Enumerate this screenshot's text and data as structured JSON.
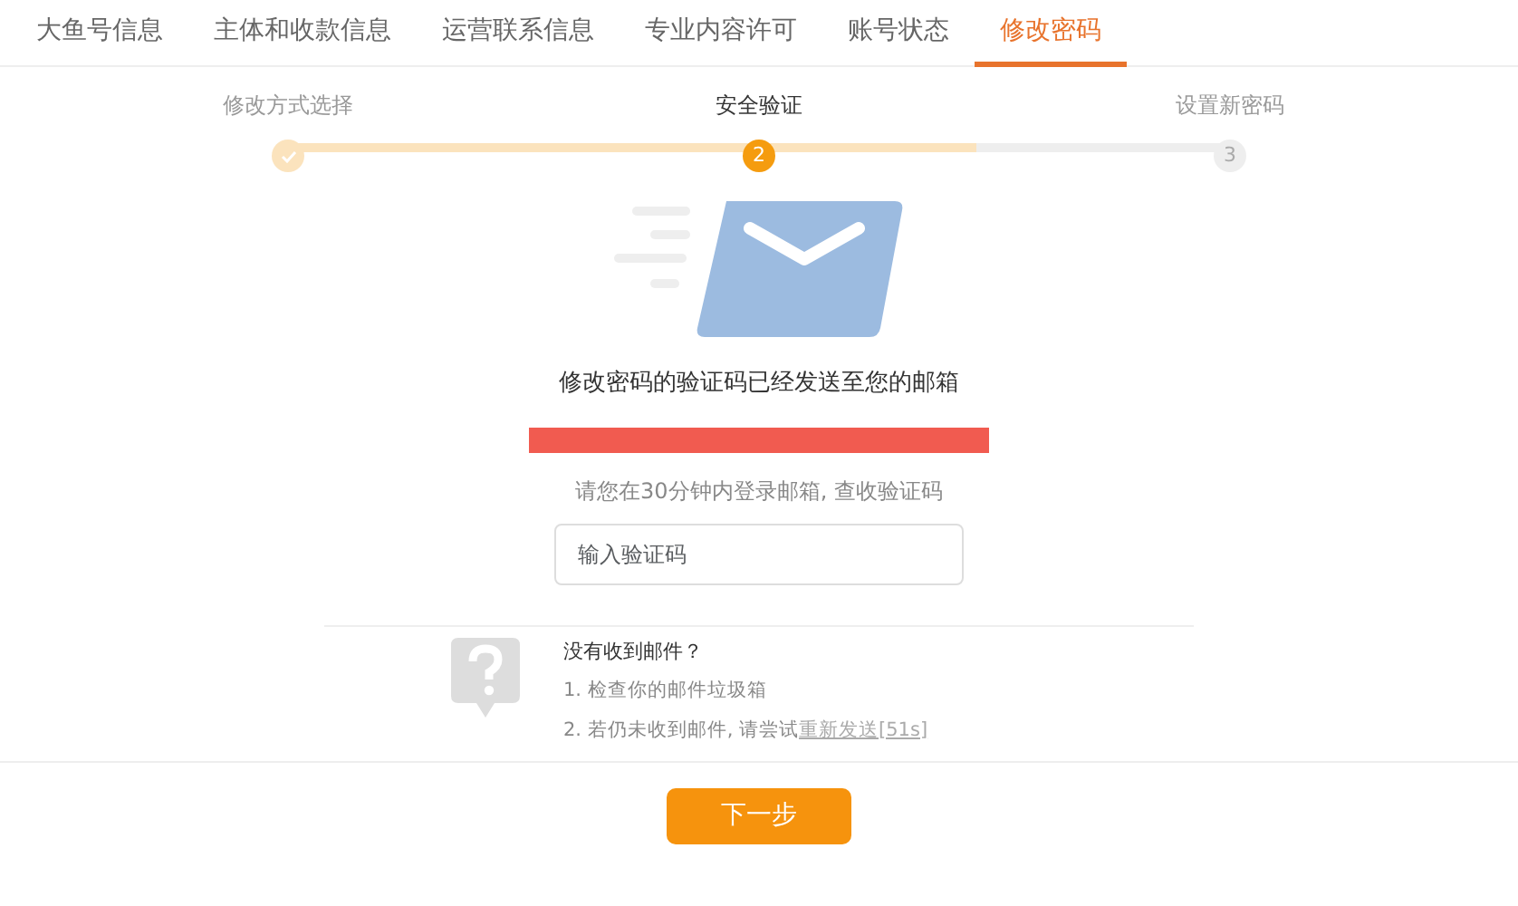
{
  "tabs": [
    {
      "label": "大鱼号信息",
      "selected": false
    },
    {
      "label": "主体和收款信息",
      "selected": false
    },
    {
      "label": "运营联系信息",
      "selected": false
    },
    {
      "label": "专业内容许可",
      "selected": false
    },
    {
      "label": "账号状态",
      "selected": false
    },
    {
      "label": "修改密码",
      "selected": true
    }
  ],
  "steps": [
    {
      "label": "修改方式选择",
      "completed": true,
      "selected": false
    },
    {
      "label": "安全验证",
      "completed": false,
      "selected": true,
      "number": "2"
    },
    {
      "label": "设置新密码",
      "completed": false,
      "selected": false,
      "number": "3"
    }
  ],
  "progress": {
    "level": 0.73
  },
  "message": "修改密码的验证码已经发送至您的邮箱",
  "email": {
    "redacted": true
  },
  "hint": "请您在30分钟内登录邮箱, 查收验证码",
  "code_field": {
    "placeholder": "输入验证码"
  },
  "help": {
    "title": "没有收到邮件？",
    "lines": [
      {
        "text": "1. 检查你的邮件垃圾箱"
      },
      {
        "text": "2. 若仍未收到邮件, 请尝试",
        "link": "重新发送[51s]"
      }
    ]
  },
  "next_button": "下一步"
}
